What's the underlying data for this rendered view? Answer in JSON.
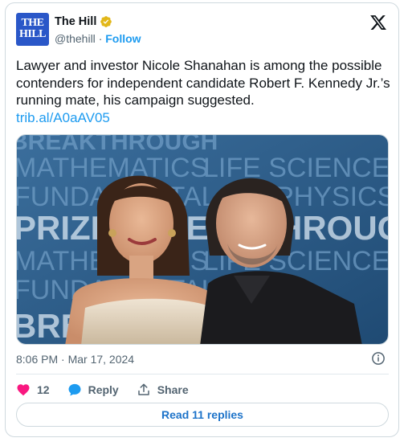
{
  "account": {
    "logo_text_1": "THE",
    "logo_text_2": "HILL",
    "name": "The Hill",
    "handle": "@thehill",
    "separator": "·",
    "follow_label": "Follow",
    "verified_color": "#e2b719",
    "logo_color": "#2a57c8"
  },
  "tweet": {
    "text": "Lawyer and investor Nicole Shanahan is among the possible contenders for independent candidate Robert F. Kennedy Jr.’s running mate, his campaign suggested.",
    "link": "trib.al/A0aAV05",
    "timestamp": "8:06 PM · Mar 17, 2024"
  },
  "photo": {
    "backdrop_words": [
      "BREAKTHROUGH",
      "MATHEMATICS",
      "LIFE SCIENCES",
      "FUNDAMENTAL",
      "PHYSICS",
      "PRIZE",
      "BREAKTHROUGH",
      "MATHEMATICS",
      "LIFE SCIENCES",
      "FUNDAMENTAL",
      "BREAKTHROUGH"
    ]
  },
  "actions": {
    "like_count": "12",
    "reply_label": "Reply",
    "share_label": "Share",
    "like_color": "#f91880",
    "reply_color": "#1d9bf0"
  },
  "footer": {
    "read_replies_label": "Read 11 replies"
  }
}
